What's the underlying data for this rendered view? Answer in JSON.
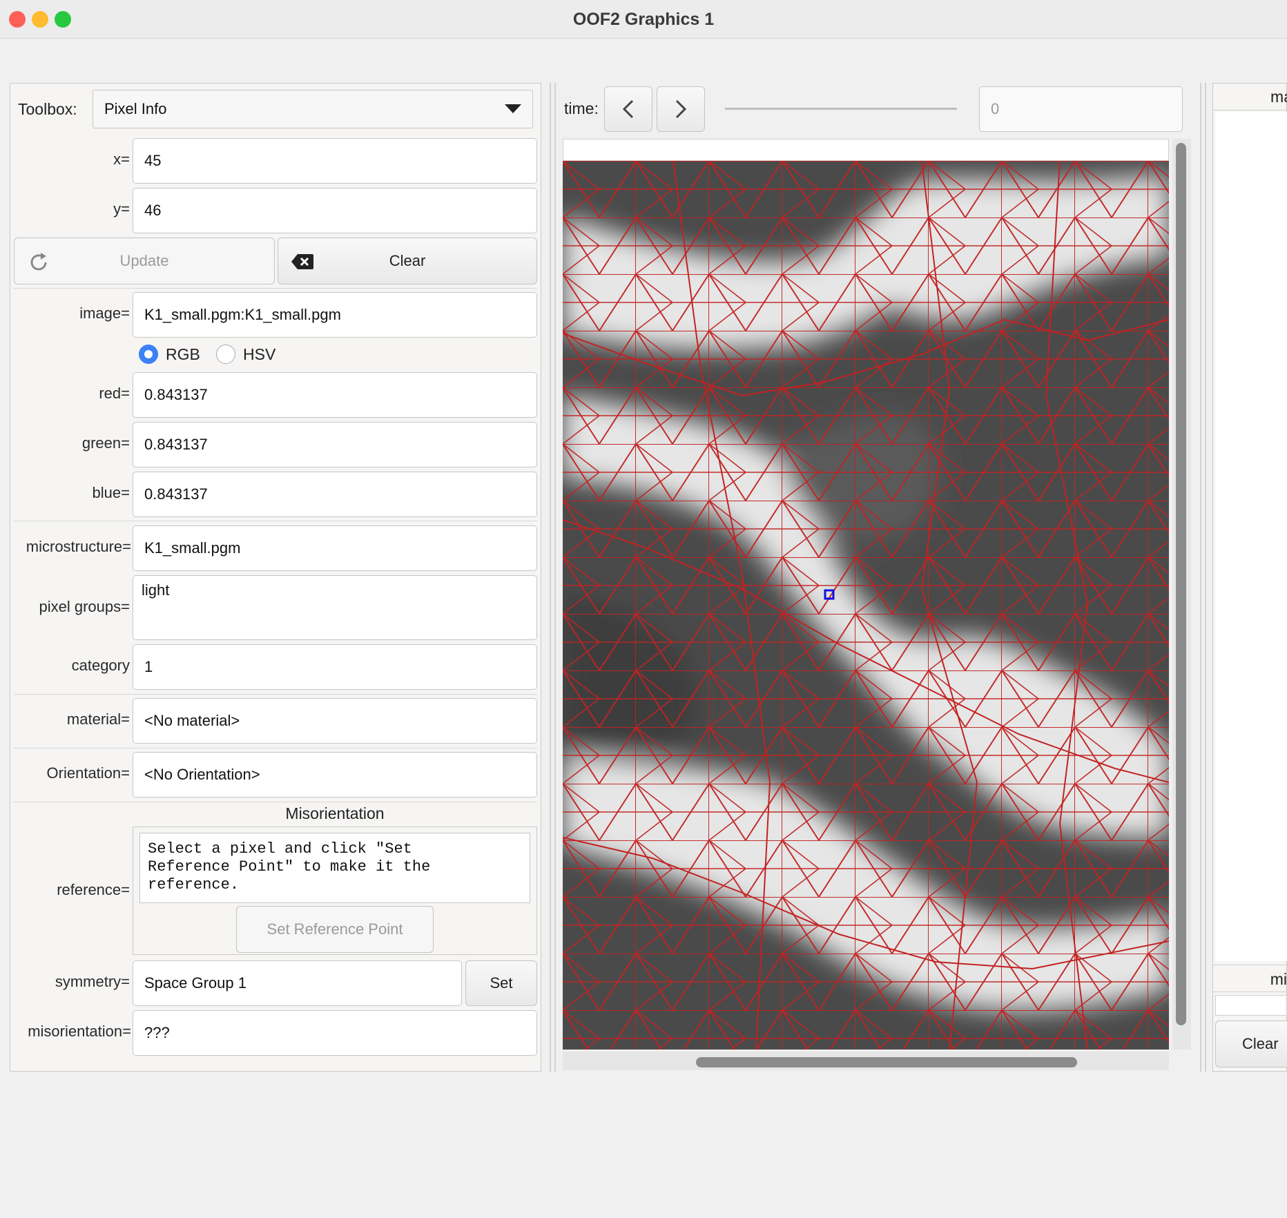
{
  "window": {
    "title": "OOF2 Graphics 1"
  },
  "toolbox": {
    "label": "Toolbox:",
    "value": "Pixel Info"
  },
  "pixel": {
    "x_label": "x=",
    "x": "45",
    "y_label": "y=",
    "y": "46",
    "update_label": "Update",
    "clear_label": "Clear"
  },
  "image": {
    "label": "image=",
    "value": "K1_small.pgm:K1_small.pgm",
    "mode_rgb": "RGB",
    "mode_hsv": "HSV",
    "mode_selected": "RGB",
    "red_label": "red=",
    "red": "0.843137",
    "green_label": "green=",
    "green": "0.843137",
    "blue_label": "blue=",
    "blue": "0.843137"
  },
  "microstructure": {
    "label": "microstructure=",
    "value": "K1_small.pgm",
    "groups_label": "pixel groups=",
    "groups": "light",
    "category_label": "category",
    "category": "1"
  },
  "material": {
    "label": "material=",
    "value": "<No material>"
  },
  "orientation": {
    "label": "Orientation=",
    "value": "<No Orientation>"
  },
  "misorientation": {
    "header": "Misorientation",
    "reference_label": "reference=",
    "reference_text": "Select a pixel and click \"Set\nReference Point\" to make it the\nreference.",
    "set_reference_label": "Set Reference Point",
    "symmetry_label": "symmetry=",
    "symmetry": "Space Group 1",
    "set_label": "Set",
    "value_label": "misorientation=",
    "value": "???"
  },
  "timebar": {
    "label": "time:",
    "value_placeholder": "0"
  },
  "right_panel": {
    "top_label": "ma",
    "bottom_label": "mi",
    "clear_label": "Clear"
  },
  "colors": {
    "mesh": "#c02020",
    "selection": "#1010e0",
    "radio": "#3b82f6"
  }
}
